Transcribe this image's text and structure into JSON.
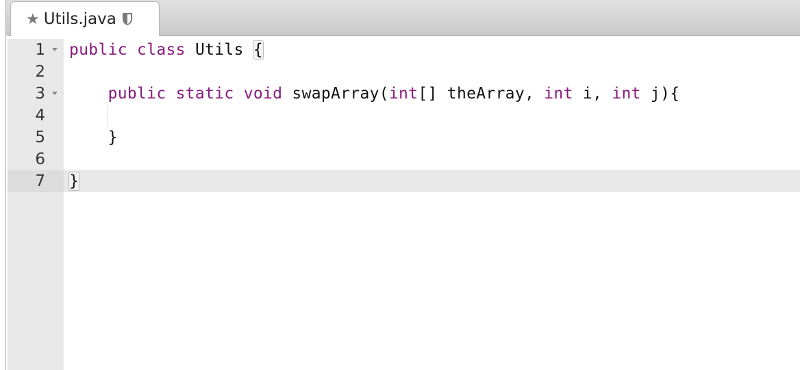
{
  "tabs": [
    {
      "label": "Utils.java",
      "starred": true,
      "icon_left": "star-icon",
      "icon_right": "shield-icon",
      "active": true
    }
  ],
  "editor": {
    "language": "java",
    "active_line": 7,
    "lines": [
      {
        "number": "1",
        "foldable": true
      },
      {
        "number": "2",
        "foldable": false
      },
      {
        "number": "3",
        "foldable": true
      },
      {
        "number": "4",
        "foldable": false
      },
      {
        "number": "5",
        "foldable": false
      },
      {
        "number": "6",
        "foldable": false
      },
      {
        "number": "7",
        "foldable": false
      }
    ],
    "tokens": {
      "l1_kw1": "public",
      "l1_sp1": " ",
      "l1_kw2": "class",
      "l1_txt": " Utils ",
      "l1_brace": "{",
      "l3_indent": "    ",
      "l3_kw1": "public",
      "l3_kw2": "static",
      "l3_kw3": "void",
      "l3_name": " swapArray(",
      "l3_kw4": "int",
      "l3_p1": "[] theArray, ",
      "l3_kw5": "int",
      "l3_p2": " i, ",
      "l3_kw6": "int",
      "l3_p3": " j){",
      "l5_text": "    }",
      "l7_brace": "}"
    }
  },
  "colors": {
    "keyword": "#8a1a7f",
    "text": "#111111",
    "gutter_bg": "#e8e8e8",
    "active_line_bg": "#e8e8e8"
  }
}
